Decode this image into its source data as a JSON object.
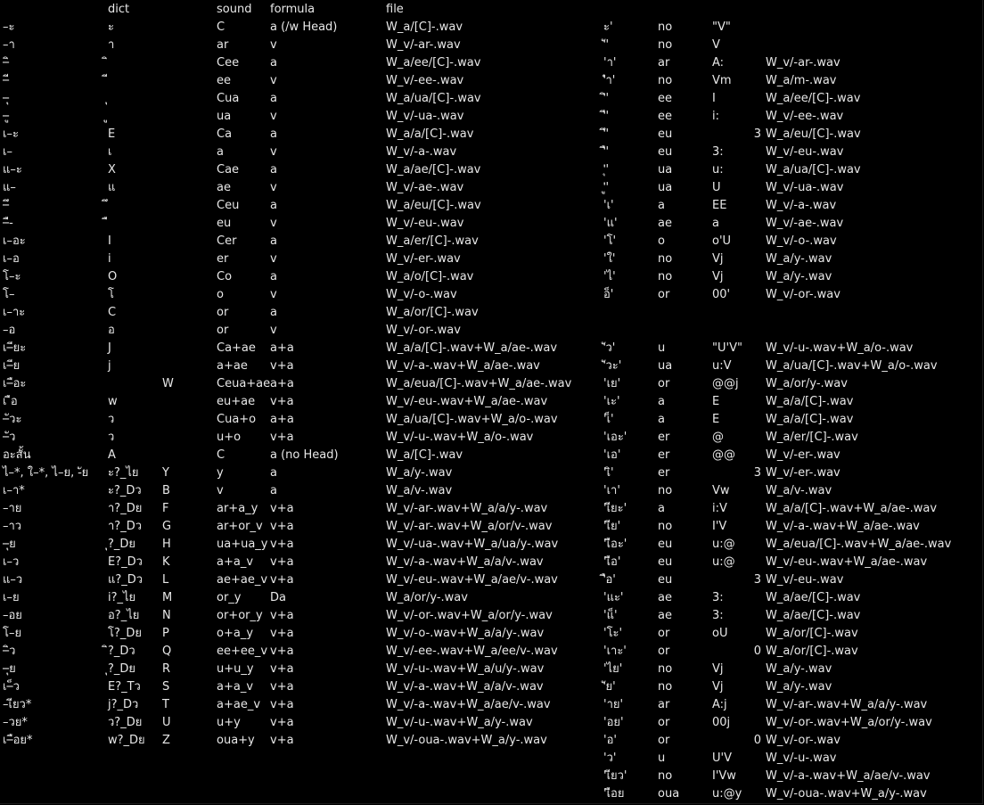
{
  "headers": {
    "dict": "dict",
    "sound": "sound",
    "formula": "formula",
    "file": "file"
  },
  "left_rows": [
    [
      "–ะ",
      "ะ",
      "",
      "C",
      "a (/w Head)",
      "W_a/[C]-.wav"
    ],
    [
      "–า",
      "า",
      "",
      "ar",
      "v",
      "W_v/-ar-.wav"
    ],
    [
      "–ิ",
      "ิ",
      "",
      "Cee",
      "a",
      "W_a/ee/[C]-.wav"
    ],
    [
      "–ี",
      "ี",
      "",
      "ee",
      "v",
      "W_v/-ee-.wav"
    ],
    [
      "–ุ",
      "ุ",
      "",
      "Cua",
      "a",
      "W_a/ua/[C]-.wav"
    ],
    [
      "–ู",
      "ู",
      "",
      "ua",
      "v",
      "W_v/-ua-.wav"
    ],
    [
      "เ–ะ",
      "E",
      "",
      "Ca",
      "a",
      "W_a/a/[C]-.wav"
    ],
    [
      "เ–",
      "เ",
      "",
      "a",
      "v",
      "W_v/-a-.wav"
    ],
    [
      "แ–ะ",
      "X",
      "",
      "Cae",
      "a",
      "W_a/ae/[C]-.wav"
    ],
    [
      "แ–",
      "แ",
      "",
      "ae",
      "v",
      "W_v/-ae-.wav"
    ],
    [
      "–ึ",
      "ึ",
      "",
      "Ceu",
      "a",
      "W_a/eu/[C]-.wav"
    ],
    [
      "–ื-",
      "ื",
      "",
      "eu",
      "v",
      "W_v/-eu-.wav"
    ],
    [
      "เ–อะ",
      "I",
      "",
      "Cer",
      "a",
      "W_a/er/[C]-.wav"
    ],
    [
      "เ–อ",
      "i",
      "",
      "er",
      "v",
      "W_v/-er-.wav"
    ],
    [
      "โ–ะ",
      "O",
      "",
      "Co",
      "a",
      "W_a/o/[C]-.wav"
    ],
    [
      "โ–",
      "โ",
      "",
      "o",
      "v",
      "W_v/-o-.wav"
    ],
    [
      "เ–าะ",
      "C",
      "",
      "or",
      "a",
      "W_a/or/[C]-.wav"
    ],
    [
      "–อ",
      "อ",
      "",
      "or",
      "v",
      "W_v/-or-.wav"
    ],
    [
      "เ–ียะ",
      "J",
      "",
      "Ca+ae",
      "a+a",
      "W_a/a/[C]-.wav+W_a/ae-.wav"
    ],
    [
      "เ–ีย",
      "j",
      "",
      "a+ae",
      "v+a",
      "W_v/-a-.wav+W_a/ae-.wav"
    ],
    [
      "เ–ือะ",
      "",
      "W",
      "Ceua+ae",
      "a+a",
      "W_a/eua/[C]-.wav+W_a/ae-.wav"
    ],
    [
      "เ ือ",
      "w",
      "",
      "eu+ae",
      "v+a",
      "W_v/-eu-.wav+W_a/ae-.wav"
    ],
    [
      "–ัวะ",
      "ว",
      "",
      "Cua+o",
      "a+a",
      "W_a/ua/[C]-.wav+W_a/o-.wav"
    ],
    [
      "–ัว",
      "ว",
      "",
      "u+o",
      "v+a",
      "W_v/-u-.wav+W_a/o-.wav"
    ],
    [
      "อะสั้น",
      "A",
      "",
      "C",
      "a (no Head)",
      "W_a/[C]-.wav"
    ],
    [
      "ไ–*, ใ–*, ไ–ย, -ัย",
      "ะ?_ไย",
      "Y",
      "y",
      "a",
      "W_a/y-.wav"
    ],
    [
      "เ–า*",
      "ะ?_Dว",
      "B",
      "v",
      "a",
      "W_a/v-.wav"
    ],
    [
      "–าย",
      "า?_Dย",
      "F",
      "ar+a_y",
      "v+a",
      "W_v/-ar-.wav+W_a/a/y-.wav"
    ],
    [
      "–าว",
      "า?_Dว",
      "G",
      "ar+or_v",
      "v+a",
      "W_v/-ar-.wav+W_a/or/v-.wav"
    ],
    [
      "–ุย",
      "ุ?_Dย",
      "H",
      "ua+ua_y",
      "v+a",
      "W_v/-ua-.wav+W_a/ua/y-.wav"
    ],
    [
      "เ–ว",
      "E?_Dว",
      "K",
      "a+a_v",
      "v+a",
      "W_v/-a-.wav+W_a/a/v-.wav"
    ],
    [
      "แ–ว",
      "แ?_Dว",
      "L",
      "ae+ae_v",
      "v+a",
      "W_v/-eu-.wav+W_a/ae/v-.wav"
    ],
    [
      "เ–ย",
      "i?_ไย",
      "M",
      "or_y",
      "Da",
      "W_a/or/y-.wav"
    ],
    [
      "–อย",
      "อ?_ไย",
      "N",
      "or+or_y",
      "v+a",
      "W_v/-or-.wav+W_a/or/y-.wav"
    ],
    [
      "โ–ย",
      "โ?_Dย",
      "P",
      "o+a_y",
      "v+a",
      "W_v/-o-.wav+W_a/a/y-.wav"
    ],
    [
      "–ิว",
      "ิ?_Dว",
      "Q",
      "ee+ee_v",
      "v+a",
      "W_v/-ee-.wav+W_a/ee/v-.wav"
    ],
    [
      "–ุย",
      "ุ?_Dย",
      "R",
      "u+u_y",
      "v+a",
      "W_v/-u-.wav+W_a/u/y-.wav"
    ],
    [
      "เ–็ว",
      "E?_Tว",
      "S",
      "a+a_v",
      "v+a",
      "W_v/-a-.wav+W_a/a/v-.wav"
    ],
    [
      "–เียว*",
      "j?_Dว",
      "T",
      "a+ae_v",
      "v+a",
      "W_v/-a-.wav+W_a/ae/v-.wav"
    ],
    [
      "–วย*",
      "ว?_Dย",
      "U",
      "u+y",
      "v+a",
      "W_v/-u-.wav+W_a/y-.wav"
    ],
    [
      "เ–ือย*",
      "w?_Dย",
      "Z",
      "oua+y",
      "v+a",
      "W_v/-oua-.wav+W_a/y-.wav"
    ]
  ],
  "right_rows": [
    [
      "ะ'",
      "no",
      "\"V\"",
      "",
      ""
    ],
    [
      "'ั'",
      "no",
      "V",
      "",
      ""
    ],
    [
      "'า'",
      "ar",
      "A:",
      "",
      "W_v/-ar-.wav"
    ],
    [
      "'ำ'",
      "no",
      "Vm",
      "",
      "W_a/m-.wav"
    ],
    [
      "'ิ'",
      "ee",
      "I",
      "",
      "W_a/ee/[C]-.wav"
    ],
    [
      "'ี'",
      "ee",
      "i:",
      "",
      "W_v/-ee-.wav"
    ],
    [
      "'ึ'",
      "eu",
      "",
      "3",
      "W_a/eu/[C]-.wav"
    ],
    [
      "'ื'",
      "eu",
      "3:",
      "",
      "W_v/-eu-.wav"
    ],
    [
      "'ุ'",
      "ua",
      "u:",
      "",
      "W_a/ua/[C]-.wav"
    ],
    [
      "'ู'",
      "ua",
      "U",
      "",
      "W_v/-ua-.wav"
    ],
    [
      "'เ'",
      "a",
      "EE",
      "",
      "W_v/-a-.wav"
    ],
    [
      "'แ'",
      "ae",
      "a",
      "",
      "W_v/-ae-.wav"
    ],
    [
      "'โ'",
      "o",
      "o'U",
      "",
      "W_v/-o-.wav"
    ],
    [
      "'ใ'",
      "no",
      "Vj",
      "",
      "W_a/y-.wav"
    ],
    [
      "'ไ'",
      "no",
      "Vj",
      "",
      "W_a/y-.wav"
    ],
    [
      "อ็'",
      "or",
      "00'",
      "",
      "W_v/-or-.wav"
    ],
    [
      "",
      "",
      "",
      "",
      ""
    ],
    [
      "",
      "",
      "",
      "",
      ""
    ],
    [
      "'ัว'",
      "u",
      "\"U'V\"",
      "",
      "W_v/-u-.wav+W_a/o-.wav"
    ],
    [
      "'ัวะ'",
      "ua",
      "u:V",
      "",
      "W_a/ua/[C]-.wav+W_a/o-.wav"
    ],
    [
      "'เย'",
      "or",
      "@@j",
      "",
      "W_a/or/y-.wav"
    ],
    [
      "'เะ'",
      "a",
      "E",
      "",
      "W_a/a/[C]-.wav"
    ],
    [
      "'เ็'",
      "a",
      "E",
      "",
      "W_a/a/[C]-.wav"
    ],
    [
      "'เอะ'",
      "er",
      "@",
      "",
      "W_a/er/[C]-.wav"
    ],
    [
      "'เอ'",
      "er",
      "@@",
      "",
      "W_v/-er-.wav"
    ],
    [
      "'เิ'",
      "er",
      "",
      "3",
      "W_v/-er-.wav"
    ],
    [
      "'เา'",
      "no",
      "Vw",
      "",
      "W_a/v-.wav"
    ],
    [
      "'เียะ'",
      "a",
      "i:V",
      "",
      "W_a/a/[C]-.wav+W_a/ae-.wav"
    ],
    [
      "'เีย'",
      "no",
      "I'V",
      "",
      "W_v/-a-.wav+W_a/ae-.wav"
    ],
    [
      "'เือะ'",
      "eu",
      "u:@",
      "",
      "W_a/eua/[C]-.wav+W_a/ae-.wav"
    ],
    [
      "'เือ'",
      "eu",
      "u:@",
      "",
      "W_v/-eu-.wav+W_a/ae-.wav"
    ],
    [
      "'ือ'",
      "eu",
      "",
      "3",
      "W_v/-eu-.wav"
    ],
    [
      "'แะ'",
      "ae",
      "3:",
      "",
      "W_a/ae/[C]-.wav"
    ],
    [
      "'แ็'",
      "ae",
      "3:",
      "",
      "W_a/ae/[C]-.wav"
    ],
    [
      "'โะ'",
      "or",
      "oU",
      "",
      "W_a/or/[C]-.wav"
    ],
    [
      "'เาะ'",
      "or",
      "",
      "0",
      "W_a/or/[C]-.wav"
    ],
    [
      "'ไย'",
      "no",
      "Vj",
      "",
      "W_a/y-.wav"
    ],
    [
      "'ัย'",
      "no",
      "Vj",
      "",
      "W_a/y-.wav"
    ],
    [
      "'าย'",
      "ar",
      "A:j",
      "",
      "W_v/-ar-.wav+W_a/a/y-.wav"
    ],
    [
      "'อย'",
      "or",
      "00j",
      "",
      "W_v/-or-.wav+W_a/or/y-.wav"
    ],
    [
      "'อ'",
      "or",
      "",
      "0",
      "W_v/-or-.wav"
    ],
    [
      "'ว'",
      "u",
      "U'V",
      "",
      "W_v/-u-.wav"
    ],
    [
      "'เียว'",
      "no",
      "I'Vw",
      "",
      "W_v/-a-.wav+W_a/ae/v-.wav"
    ],
    [
      "'เือย",
      "oua",
      "u:@y",
      "",
      "W_v/-oua-.wav+W_a/y-.wav"
    ]
  ]
}
